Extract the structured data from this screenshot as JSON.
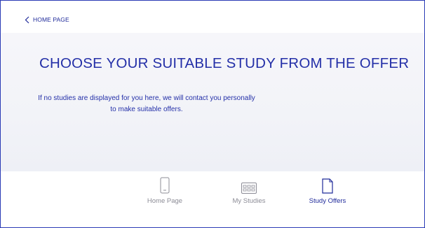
{
  "header": {
    "back_label": "HOME PAGE",
    "back_icon": "chevron-left-icon"
  },
  "hero": {
    "title": "CHOOSE YOUR SUITABLE STUDY FROM THE OFFER",
    "note": "If no studies are displayed for you here, we will contact you personally to make suitable offers."
  },
  "nav": {
    "items": [
      {
        "label": "Home Page",
        "icon": "phone-icon",
        "active": false
      },
      {
        "label": "My Studies",
        "icon": "studies-grid-icon",
        "active": false
      },
      {
        "label": "Study Offers",
        "icon": "document-icon",
        "active": true
      }
    ]
  },
  "colors": {
    "accent": "#2430a8",
    "border": "#2a3bb5",
    "inactive": "#8c8c96",
    "hero_bg": "#f3f4f9"
  }
}
